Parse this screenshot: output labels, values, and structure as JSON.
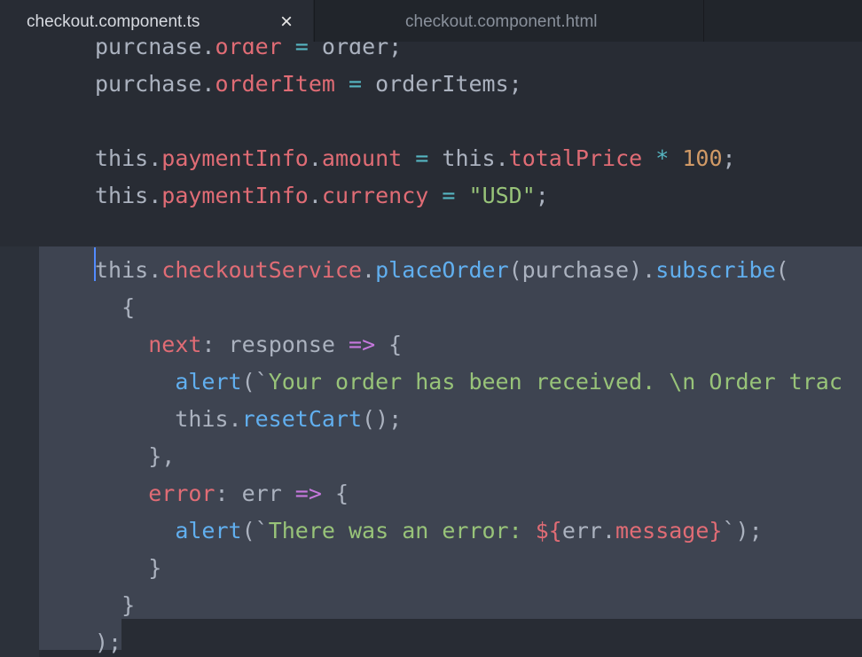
{
  "tabs": [
    {
      "label": "checkout.component.ts",
      "active": true,
      "close_icon": "×"
    },
    {
      "label": "checkout.component.html",
      "active": false
    }
  ],
  "colors": {
    "background": "#282c34",
    "selection": "#3e4451",
    "property": "#e06c75",
    "function": "#61afef",
    "string": "#98c379",
    "number": "#d19a66",
    "operator": "#56b6c2",
    "keyword": "#c678dd",
    "text": "#abb2bf",
    "cursor": "#528bff"
  },
  "code_lines": [
    [
      [
        "plain",
        "purchase."
      ],
      [
        "prop",
        "order"
      ],
      [
        "plain",
        " "
      ],
      [
        "op",
        "="
      ],
      [
        "plain",
        " order;"
      ]
    ],
    [
      [
        "plain",
        "purchase."
      ],
      [
        "prop",
        "orderItem"
      ],
      [
        "plain",
        " "
      ],
      [
        "op",
        "="
      ],
      [
        "plain",
        " orderItems;"
      ]
    ],
    [],
    [
      [
        "plain",
        "this."
      ],
      [
        "prop",
        "paymentInfo"
      ],
      [
        "plain",
        "."
      ],
      [
        "prop",
        "amount"
      ],
      [
        "plain",
        " "
      ],
      [
        "op",
        "="
      ],
      [
        "plain",
        " this."
      ],
      [
        "prop",
        "totalPrice"
      ],
      [
        "plain",
        " "
      ],
      [
        "op",
        "*"
      ],
      [
        "plain",
        " "
      ],
      [
        "num",
        "100"
      ],
      [
        "plain",
        ";"
      ]
    ],
    [
      [
        "plain",
        "this."
      ],
      [
        "prop",
        "paymentInfo"
      ],
      [
        "plain",
        "."
      ],
      [
        "prop",
        "currency"
      ],
      [
        "plain",
        " "
      ],
      [
        "op",
        "="
      ],
      [
        "plain",
        " "
      ],
      [
        "str",
        "\"USD\""
      ],
      [
        "plain",
        ";"
      ]
    ],
    [],
    [
      [
        "plain",
        "this."
      ],
      [
        "prop",
        "checkoutService"
      ],
      [
        "plain",
        "."
      ],
      [
        "fn",
        "placeOrder"
      ],
      [
        "plain",
        "(purchase)."
      ],
      [
        "fn",
        "subscribe"
      ],
      [
        "plain",
        "("
      ]
    ],
    [
      [
        "plain",
        "  {"
      ]
    ],
    [
      [
        "plain",
        "    "
      ],
      [
        "prop",
        "next"
      ],
      [
        "plain",
        ": response "
      ],
      [
        "kw",
        "=>"
      ],
      [
        "plain",
        " {"
      ]
    ],
    [
      [
        "plain",
        "      "
      ],
      [
        "fn",
        "alert"
      ],
      [
        "plain",
        "(`"
      ],
      [
        "str",
        "Your order has been received. \\n Order trac"
      ]
    ],
    [
      [
        "plain",
        "      this."
      ],
      [
        "fn",
        "resetCart"
      ],
      [
        "plain",
        "();"
      ]
    ],
    [
      [
        "plain",
        "    },"
      ]
    ],
    [
      [
        "plain",
        "    "
      ],
      [
        "prop",
        "error"
      ],
      [
        "plain",
        ": err "
      ],
      [
        "kw",
        "=>"
      ],
      [
        "plain",
        " {"
      ]
    ],
    [
      [
        "plain",
        "      "
      ],
      [
        "fn",
        "alert"
      ],
      [
        "plain",
        "(`"
      ],
      [
        "str",
        "There was an error: "
      ],
      [
        "prop",
        "${"
      ],
      [
        "plain",
        "err."
      ],
      [
        "prop",
        "message"
      ],
      [
        "prop",
        "}"
      ],
      [
        "plain",
        "`);"
      ]
    ],
    [
      [
        "plain",
        "    }"
      ]
    ],
    [
      [
        "plain",
        "  }"
      ]
    ],
    [
      [
        "plain",
        ");"
      ]
    ]
  ]
}
